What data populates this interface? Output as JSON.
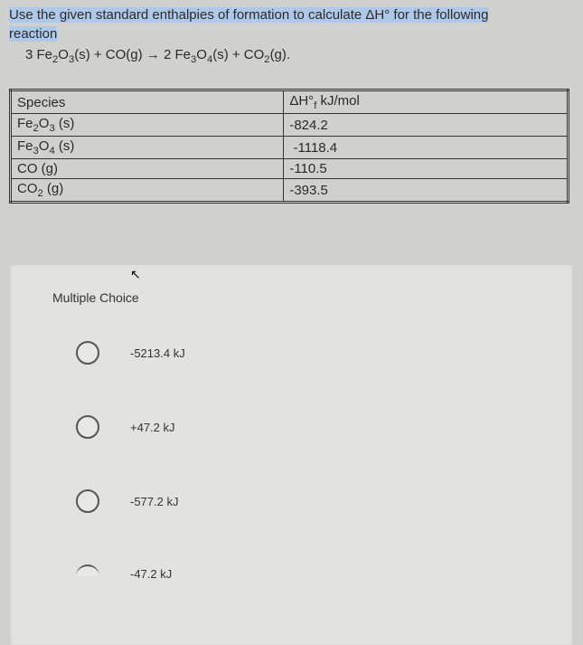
{
  "question": {
    "line1": "Use the given standard enthalpies of formation to calculate ΔH° for the following",
    "line2": "reaction",
    "equation_html": "3 Fe<sub>2</sub>O<sub>3</sub>(s) + CO(g) → 2 Fe<sub>3</sub>O<sub>4</sub>(s) + CO<sub>2</sub>(g)."
  },
  "table": {
    "headers": {
      "species": "Species",
      "value": "ΔH°f kJ/mol"
    },
    "rows": [
      {
        "species_html": "Fe<sub>2</sub>O<sub>3</sub> (s)",
        "value": "-824.2"
      },
      {
        "species_html": "Fe<sub>3</sub>O<sub>4</sub> (s)",
        "value": "-1118.4"
      },
      {
        "species_html": "CO (g)",
        "value": "-110.5"
      },
      {
        "species_html": "CO<sub>2</sub> (g)",
        "value": "-393.5"
      }
    ]
  },
  "mc": {
    "title": "Multiple Choice",
    "options": [
      {
        "label": "-5213.4 kJ"
      },
      {
        "label": "+47.2 kJ"
      },
      {
        "label": "-577.2 kJ"
      },
      {
        "label": "-47.2 kJ"
      }
    ]
  }
}
